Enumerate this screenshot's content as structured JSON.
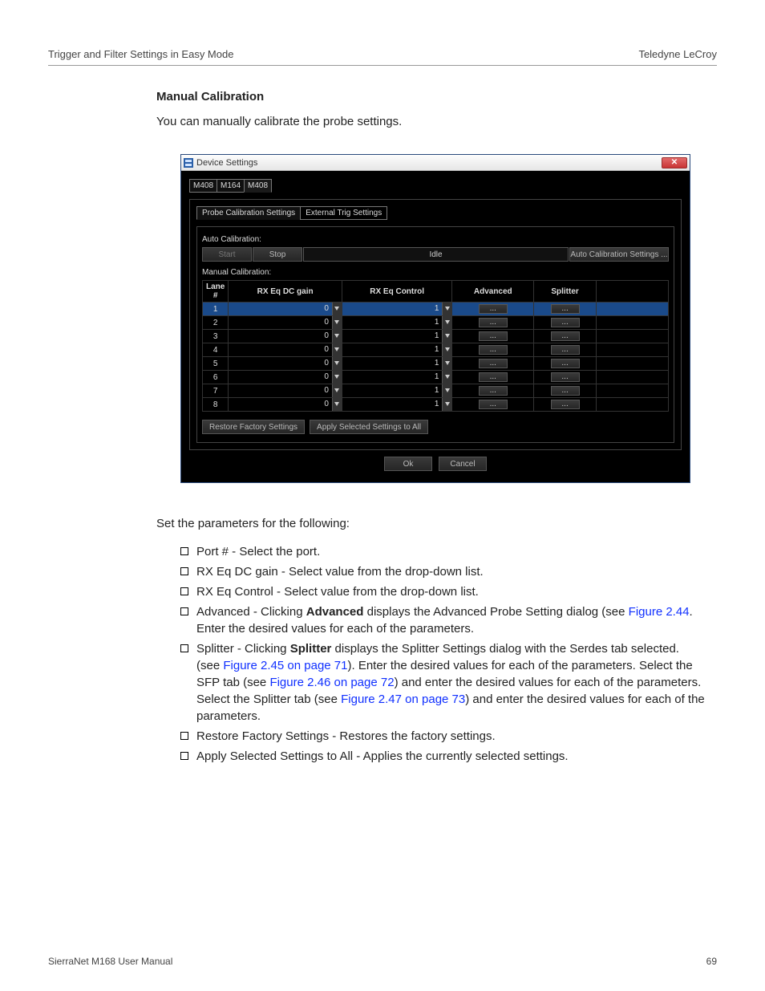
{
  "header": {
    "left": "Trigger and Filter Settings in Easy Mode",
    "right": "Teledyne LeCroy"
  },
  "section": {
    "title": "Manual Calibration",
    "intro": "You can manually calibrate the probe settings.",
    "after_params_intro": "Set the parameters for the following:"
  },
  "dialog": {
    "title": "Device Settings",
    "device_tabs": [
      "M408",
      "M164",
      "M408"
    ],
    "active_device_tab": 2,
    "sub_tabs": [
      "Probe Calibration Settings",
      "External Trig Settings"
    ],
    "active_sub_tab": 0,
    "auto_label": "Auto Calibration:",
    "start": "Start",
    "stop": "Stop",
    "status": "Idle",
    "auto_settings_btn": "Auto Calibration Settings ...",
    "manual_label": "Manual Calibration:",
    "table": {
      "headers": [
        "Lane #",
        "RX Eq DC gain",
        "RX Eq Control",
        "Advanced",
        "Splitter"
      ],
      "rows": [
        {
          "lane": "1",
          "dc_gain": "0",
          "eq_ctrl": "1",
          "advanced": "...",
          "splitter": "..."
        },
        {
          "lane": "2",
          "dc_gain": "0",
          "eq_ctrl": "1",
          "advanced": "...",
          "splitter": "..."
        },
        {
          "lane": "3",
          "dc_gain": "0",
          "eq_ctrl": "1",
          "advanced": "...",
          "splitter": "..."
        },
        {
          "lane": "4",
          "dc_gain": "0",
          "eq_ctrl": "1",
          "advanced": "...",
          "splitter": "..."
        },
        {
          "lane": "5",
          "dc_gain": "0",
          "eq_ctrl": "1",
          "advanced": "...",
          "splitter": "..."
        },
        {
          "lane": "6",
          "dc_gain": "0",
          "eq_ctrl": "1",
          "advanced": "...",
          "splitter": "..."
        },
        {
          "lane": "7",
          "dc_gain": "0",
          "eq_ctrl": "1",
          "advanced": "...",
          "splitter": "..."
        },
        {
          "lane": "8",
          "dc_gain": "0",
          "eq_ctrl": "1",
          "advanced": "...",
          "splitter": "..."
        }
      ]
    },
    "restore_btn": "Restore Factory Settings",
    "apply_all_btn": "Apply Selected Settings to All",
    "ok": "Ok",
    "cancel": "Cancel"
  },
  "bullets": {
    "b0": "Port # - Select the port.",
    "b1": "RX Eq DC gain - Select value from the drop-down list.",
    "b2": "RX Eq Control - Select value from the drop-down list.",
    "b3_pre": "Advanced - Clicking ",
    "b3_bold": "Advanced",
    "b3_mid": " displays the Advanced Probe Setting dialog (see ",
    "b3_xref": "Figure 2.44",
    "b3_post": ". Enter the desired values for each of the parameters.",
    "b4_pre": "Splitter - Clicking ",
    "b4_bold": "Splitter",
    "b4_mid1": " displays the Splitter Settings dialog with the Serdes tab selected. (see ",
    "b4_xref1": "Figure 2.45 on page 71",
    "b4_mid2": "). Enter the desired values for each of the parameters. Select the SFP tab (see ",
    "b4_xref2": "Figure 2.46 on page 72",
    "b4_mid3": ") and enter the desired values for each of the parameters. Select the Splitter tab (see ",
    "b4_xref3": "Figure 2.47 on page 73",
    "b4_post": ") and enter the desired values for each of the parameters.",
    "b5": "Restore Factory Settings - Restores the factory settings.",
    "b6": "Apply Selected Settings to All - Applies the currently selected settings."
  },
  "footer": {
    "left": "SierraNet M168 User Manual",
    "right": "69"
  }
}
